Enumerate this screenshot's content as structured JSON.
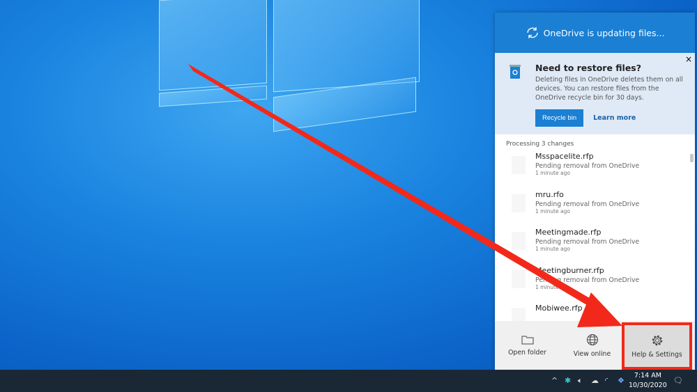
{
  "header": {
    "title": "OneDrive is updating files...",
    "icon": "sync-icon"
  },
  "banner": {
    "title": "Need to restore files?",
    "body": "Deleting files in OneDrive deletes them on all devices. You can restore files from the OneDrive recycle bin for 30 days.",
    "recycle_label": "Recycle bin",
    "learn_label": "Learn more",
    "close": "×"
  },
  "list": {
    "heading": "Processing 3 changes",
    "items": [
      {
        "name": "Msspacelite.rfp",
        "status": "Pending removal from OneDrive",
        "time": "1 minute ago"
      },
      {
        "name": "mru.rfo",
        "status": "Pending removal from OneDrive",
        "time": "1 minute ago"
      },
      {
        "name": "Meetingmade.rfp",
        "status": "Pending removal from OneDrive",
        "time": "1 minute ago"
      },
      {
        "name": "Meetingburner.rfp",
        "status": "Pending removal from OneDrive",
        "time": "1 minute ago"
      },
      {
        "name": "Mobiwee.rfp",
        "status": "",
        "time": ""
      }
    ]
  },
  "footer": {
    "open_folder": "Open folder",
    "view_online": "View online",
    "help_settings": "Help & Settings"
  },
  "taskbar": {
    "time": "7:14 AM",
    "date": "10/30/2020"
  },
  "colors": {
    "accent": "#1b7fd3",
    "highlight": "#f2291a"
  }
}
